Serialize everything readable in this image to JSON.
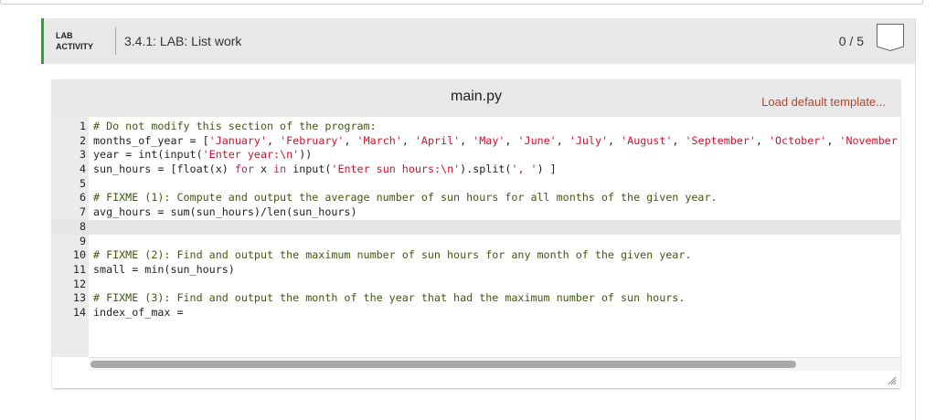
{
  "lab": {
    "type_label_1": "LAB",
    "type_label_2": "ACTIVITY",
    "title": "3.4.1: LAB: List work",
    "score": "0 / 5",
    "accent": "#2da52d"
  },
  "editor": {
    "filename": "main.py",
    "load_template": "Load default template...",
    "active_line": 8,
    "lines": [
      {
        "n": "1",
        "tokens": [
          {
            "t": "comment",
            "v": "# Do not modify this section of the program:"
          }
        ]
      },
      {
        "n": "2",
        "tokens": [
          {
            "t": "plain",
            "v": "months_of_year = ["
          },
          {
            "t": "string",
            "v": "'January'"
          },
          {
            "t": "plain",
            "v": ", "
          },
          {
            "t": "string",
            "v": "'February'"
          },
          {
            "t": "plain",
            "v": ", "
          },
          {
            "t": "string",
            "v": "'March'"
          },
          {
            "t": "plain",
            "v": ", "
          },
          {
            "t": "string",
            "v": "'April'"
          },
          {
            "t": "plain",
            "v": ", "
          },
          {
            "t": "string",
            "v": "'May'"
          },
          {
            "t": "plain",
            "v": ", "
          },
          {
            "t": "string",
            "v": "'June'"
          },
          {
            "t": "plain",
            "v": ", "
          },
          {
            "t": "string",
            "v": "'July'"
          },
          {
            "t": "plain",
            "v": ", "
          },
          {
            "t": "string",
            "v": "'August'"
          },
          {
            "t": "plain",
            "v": ", "
          },
          {
            "t": "string",
            "v": "'September'"
          },
          {
            "t": "plain",
            "v": ", "
          },
          {
            "t": "string",
            "v": "'October'"
          },
          {
            "t": "plain",
            "v": ", "
          },
          {
            "t": "string",
            "v": "'November"
          }
        ]
      },
      {
        "n": "3",
        "tokens": [
          {
            "t": "plain",
            "v": "year = int(input("
          },
          {
            "t": "string",
            "v": "'Enter year:\\n'"
          },
          {
            "t": "plain",
            "v": "))"
          }
        ]
      },
      {
        "n": "4",
        "tokens": [
          {
            "t": "plain",
            "v": "sun_hours = [float(x) "
          },
          {
            "t": "keyword",
            "v": "for"
          },
          {
            "t": "plain",
            "v": " x "
          },
          {
            "t": "keyword",
            "v": "in"
          },
          {
            "t": "plain",
            "v": " input("
          },
          {
            "t": "string",
            "v": "'Enter sun hours:\\n'"
          },
          {
            "t": "plain",
            "v": ").split("
          },
          {
            "t": "string",
            "v": "', '"
          },
          {
            "t": "plain",
            "v": ") ]"
          }
        ]
      },
      {
        "n": "5",
        "tokens": []
      },
      {
        "n": "6",
        "tokens": [
          {
            "t": "comment",
            "v": "# FIXME (1): Compute and output the average number of sun hours for all months of the given year."
          }
        ]
      },
      {
        "n": "7",
        "tokens": [
          {
            "t": "plain",
            "v": "avg_hours = sum(sun_hours)/len(sun_hours)"
          }
        ]
      },
      {
        "n": "8",
        "tokens": []
      },
      {
        "n": "9",
        "tokens": []
      },
      {
        "n": "10",
        "tokens": [
          {
            "t": "comment",
            "v": "# FIXME (2): Find and output the maximum number of sun hours for any month of the given year."
          }
        ]
      },
      {
        "n": "11",
        "tokens": [
          {
            "t": "plain",
            "v": "small = min(sun_hours)"
          }
        ]
      },
      {
        "n": "12",
        "tokens": []
      },
      {
        "n": "13",
        "tokens": [
          {
            "t": "comment",
            "v": "# FIXME (3): Find and output the month of the year that had the maximum number of sun hours."
          }
        ]
      },
      {
        "n": "14",
        "tokens": [
          {
            "t": "plain",
            "v": "index_of_max = "
          }
        ]
      }
    ]
  }
}
